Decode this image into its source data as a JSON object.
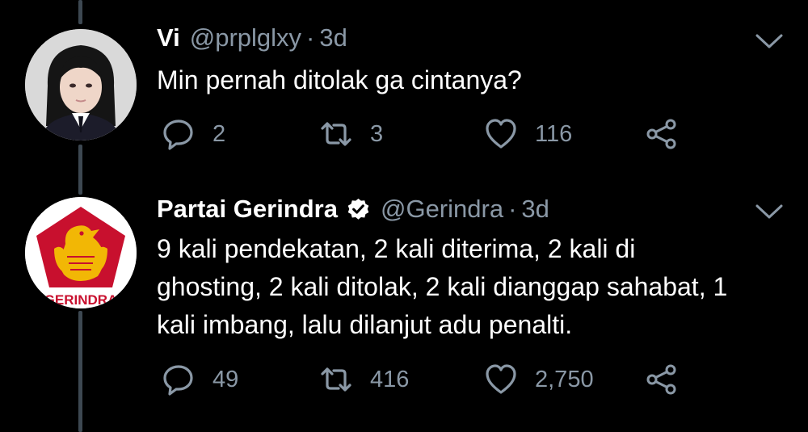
{
  "tweets": [
    {
      "name": "Vi",
      "handle": "@prplglxy",
      "separator": "·",
      "time": "3d",
      "verified": false,
      "text": [
        "Min pernah ditolak ga cintanya?"
      ],
      "replies": "2",
      "retweets": "3",
      "likes": "116"
    },
    {
      "name": "Partai Gerindra",
      "handle": "@Gerindra",
      "separator": "·",
      "time": "3d",
      "verified": true,
      "avatar_text": "GERINDRA",
      "text": [
        "9 kali pendekatan, 2 kali diterima, 2 kali di",
        "ghosting, 2 kali ditolak, 2 kali dianggap sahabat, 1",
        "kali imbang, lalu dilanjut adu penalti."
      ],
      "replies": "49",
      "retweets": "416",
      "likes": "2,750"
    }
  ],
  "colors": {
    "background": "#000000",
    "text": "#ffffff",
    "muted": "#8a98a6",
    "thread_line": "#3d4852",
    "gerindra_red": "#c8102e",
    "gerindra_gold": "#f2b705"
  },
  "icons": {
    "reply": "reply-icon",
    "retweet": "retweet-icon",
    "like": "heart-icon",
    "share": "share-icon",
    "caret": "chevron-down-icon",
    "verified": "verified-badge-icon"
  }
}
